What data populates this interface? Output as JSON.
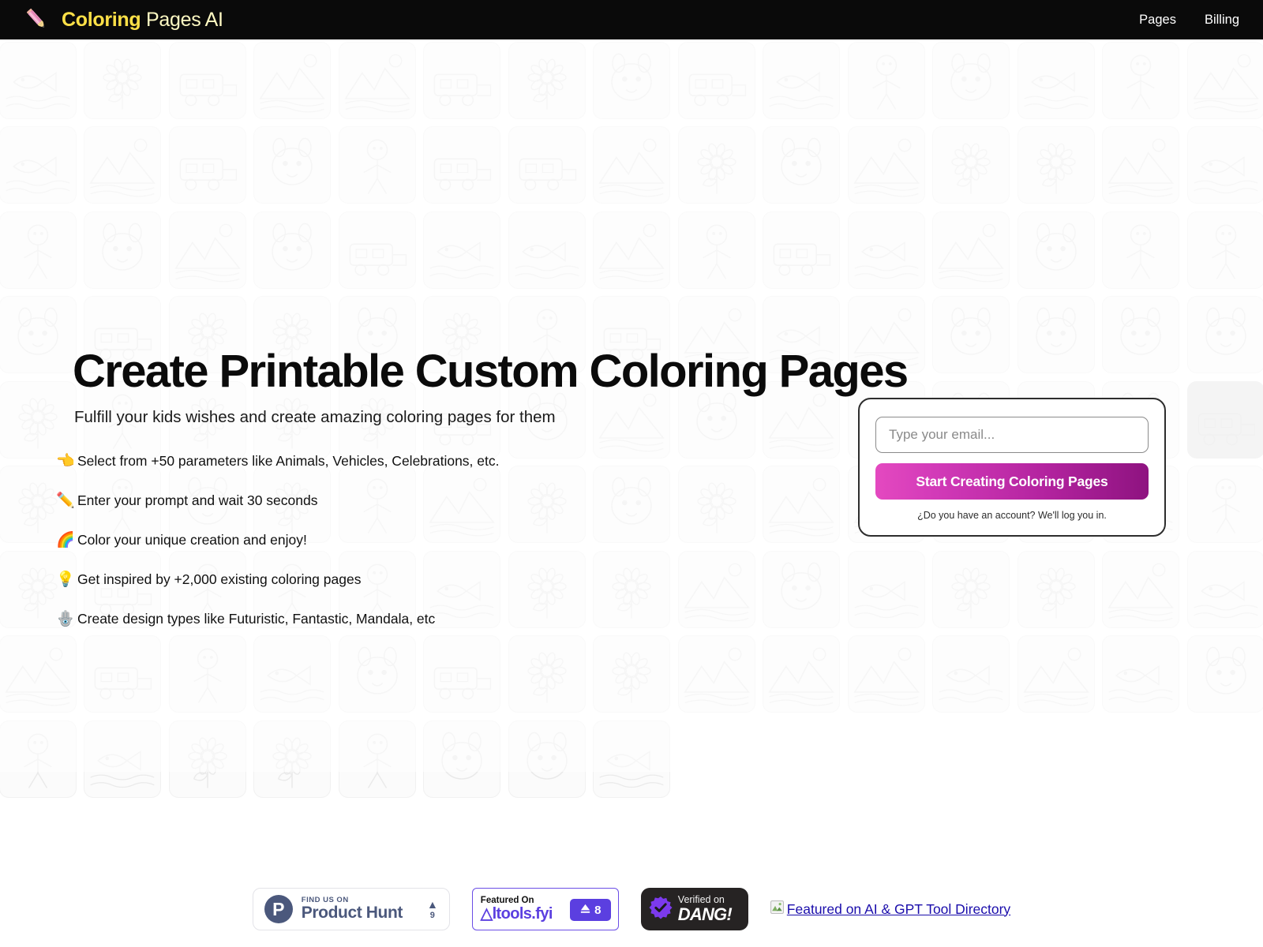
{
  "navbar": {
    "logo_icon": "pencil-icon",
    "brand_strong": "Coloring",
    "brand_light": " Pages AI",
    "links": [
      {
        "label": "Pages"
      },
      {
        "label": "Billing"
      }
    ]
  },
  "hero": {
    "title": "Create Printable Custom Coloring Pages",
    "subtitle": "Fulfill your kids wishes and create amazing coloring pages for them",
    "features": [
      {
        "emoji": "👈",
        "icon_name": "pointing-hand-icon",
        "text": "Select from +50 parameters like Animals, Vehicles, Celebrations, etc."
      },
      {
        "emoji": "✏️",
        "icon_name": "pencil-icon",
        "text": "Enter your prompt and wait 30 seconds"
      },
      {
        "emoji": "🌈",
        "icon_name": "rainbow-icon",
        "text": "Color your unique creation and enjoy!"
      },
      {
        "emoji": "💡",
        "icon_name": "lightbulb-icon",
        "text": "Get inspired by +2,000 existing coloring pages"
      },
      {
        "emoji": "🪬",
        "icon_name": "hamsa-icon",
        "text": "Create design types like Futuristic, Fantastic, Mandala, etc"
      }
    ]
  },
  "signup": {
    "email_placeholder": "Type your email...",
    "email_value": "",
    "cta_label": "Start Creating Coloring Pages",
    "note": "¿Do you have an account? We'll log you in."
  },
  "footer": {
    "product_hunt": {
      "logo_letter": "P",
      "eyebrow": "FIND US ON",
      "name": "Product Hunt",
      "caret": "▲",
      "votes": "9"
    },
    "altools": {
      "eyebrow": "Featured On",
      "name": "△ltools.fyi",
      "chip_icon": "triangle-stack-icon",
      "chip_count": "8"
    },
    "dang": {
      "seal_icon": "verified-seal-icon",
      "eyebrow": "Verified on",
      "name": "DANG!"
    },
    "directory_link": {
      "icon": "broken-image-icon",
      "label": "Featured on AI & GPT Tool Directory"
    }
  },
  "colors": {
    "navbar_bg": "#0a0a0a",
    "brand_accent": "#fde047",
    "cta_gradient_from": "#e449c0",
    "cta_gradient_to": "#8e1380",
    "product_hunt": "#4b587c",
    "altools_purple": "#5b3fe0",
    "dang_bg": "#262323",
    "link_blue": "#1a0dab"
  },
  "background": {
    "description": "faded grid of coloring-page thumbnails",
    "columns": 15,
    "rows": 9,
    "last_row_tiles": 8,
    "dark_tile_index": 74
  }
}
